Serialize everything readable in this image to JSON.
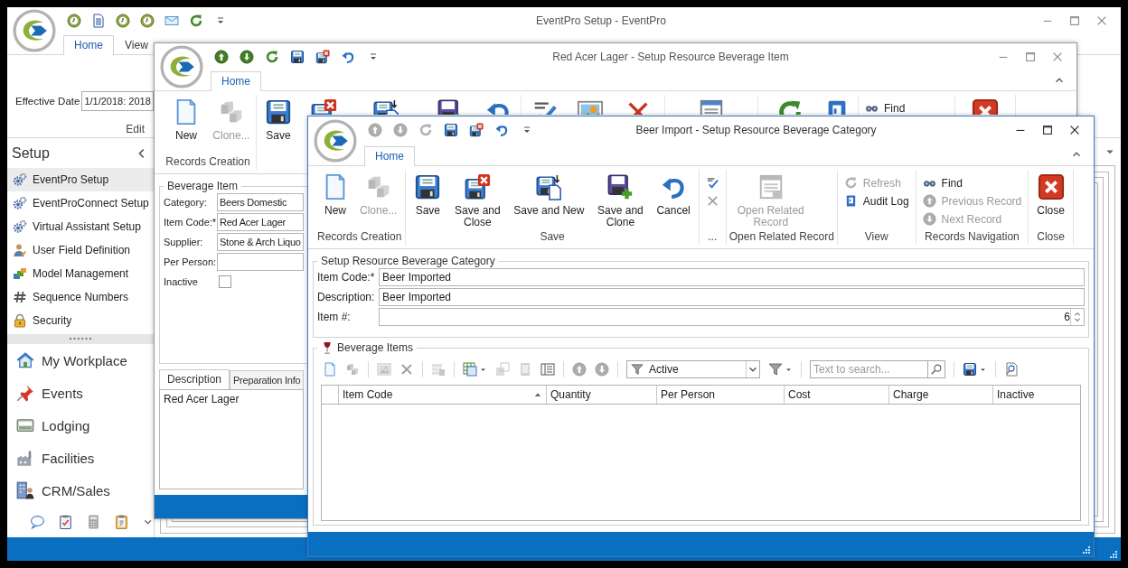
{
  "main_window": {
    "title": "EventPro Setup - EventPro",
    "quick_access": [
      {
        "kind": "clock",
        "disabled": false
      },
      {
        "kind": "doc",
        "disabled": false
      },
      {
        "kind": "clock",
        "disabled": false
      },
      {
        "kind": "clock",
        "disabled": false
      },
      {
        "kind": "mail",
        "disabled": false
      },
      {
        "kind": "refresh",
        "disabled": false
      },
      {
        "kind": "customize",
        "disabled": false
      }
    ],
    "tabs": [
      {
        "label": "Home",
        "selected": true
      },
      {
        "label": "View",
        "selected": false
      }
    ],
    "effective_date": {
      "label": "Effective Date",
      "value": "1/1/2018: 2018"
    },
    "ribbon_group": "Edit",
    "sidebar": {
      "title": "Setup",
      "items": [
        {
          "label": "EventPro Setup",
          "kind": "gear",
          "selected": true
        },
        {
          "label": "EventProConnect Setup",
          "kind": "gear",
          "selected": false
        },
        {
          "label": "Virtual Assistant Setup",
          "kind": "gear",
          "selected": false
        },
        {
          "label": "User Field Definition",
          "kind": "user",
          "selected": false
        },
        {
          "label": "Model Management",
          "kind": "model",
          "selected": false
        },
        {
          "label": "Sequence Numbers",
          "kind": "hash",
          "selected": false
        },
        {
          "label": "Security",
          "kind": "lock",
          "selected": false
        }
      ],
      "nav": [
        {
          "label": "My Workplace",
          "kind": "home"
        },
        {
          "label": "Events",
          "kind": "pin"
        },
        {
          "label": "Lodging",
          "kind": "bed"
        },
        {
          "label": "Facilities",
          "kind": "factory"
        },
        {
          "label": "CRM/Sales",
          "kind": "crm"
        }
      ],
      "shortcuts": [
        {
          "kind": "chat"
        },
        {
          "kind": "checklist"
        },
        {
          "kind": "calculator"
        },
        {
          "kind": "clipboard"
        },
        {
          "kind": "chevron_down"
        }
      ]
    }
  },
  "item_window": {
    "title": "Red Acer Lager - Setup Resource Beverage Item",
    "quick_access": [
      {
        "kind": "up",
        "disabled": false
      },
      {
        "kind": "down",
        "disabled": false
      },
      {
        "kind": "refresh",
        "disabled": false
      },
      {
        "kind": "save",
        "disabled": false
      },
      {
        "kind": "save_close",
        "disabled": false
      },
      {
        "kind": "undo",
        "disabled": false
      },
      {
        "kind": "customize",
        "disabled": false
      }
    ],
    "tabs": [
      {
        "label": "Home",
        "selected": true
      }
    ],
    "ribbon_groups": [
      {
        "label": "Records Creation",
        "kind": "large",
        "buttons": [
          {
            "kind": "new",
            "label": "New",
            "disabled": false
          },
          {
            "kind": "clone",
            "label": "Clone...",
            "disabled": true
          }
        ]
      },
      {
        "kind": "large",
        "buttons": [
          {
            "kind": "save",
            "label": "Save",
            "disabled": false
          },
          {
            "kind": "save_close",
            "disabled": false
          },
          {
            "kind": "save_new",
            "disabled": false
          },
          {
            "kind": "save_clone",
            "disabled": false
          },
          {
            "kind": "undo",
            "disabled": false
          }
        ]
      },
      {
        "kind": "large",
        "buttons": [
          {
            "kind": "spell",
            "disabled": false
          },
          {
            "kind": "picture",
            "disabled": false
          },
          {
            "kind": "delete",
            "disabled": false
          }
        ]
      },
      {
        "kind": "large",
        "buttons": [
          {
            "kind": "related",
            "disabled": false
          }
        ]
      },
      {
        "kind": "large",
        "buttons": [
          {
            "kind": "refresh",
            "disabled": false
          },
          {
            "kind": "audit",
            "disabled": false
          }
        ]
      },
      {
        "kind": "small",
        "buttons": [
          {
            "kind": "find",
            "label": "Find",
            "disabled": false
          }
        ]
      },
      {
        "kind": "large",
        "buttons": [
          {
            "kind": "close_red",
            "disabled": false
          }
        ]
      }
    ],
    "form": {
      "title": "Beverage Item",
      "fields": [
        {
          "kind": "text",
          "label": "Category:",
          "value": "Beers Domestic"
        },
        {
          "kind": "text",
          "label": "Item Code:*",
          "value": "Red Acer Lager"
        },
        {
          "kind": "text",
          "label": "Supplier:",
          "value": "Stone & Arch Liquo"
        },
        {
          "kind": "text",
          "label": "Per Person:"
        },
        {
          "kind": "checkbox",
          "label": "Inactive",
          "checked": false
        }
      ]
    },
    "detail_tabs": [
      {
        "label": "Description",
        "selected": true
      },
      {
        "label": "Preparation Info",
        "selected": false
      }
    ],
    "description": "Red Acer Lager"
  },
  "category_window": {
    "title": "Beer Import - Setup Resource Beverage Category",
    "quick_access": [
      {
        "kind": "up",
        "disabled": true
      },
      {
        "kind": "down",
        "disabled": true
      },
      {
        "kind": "refresh",
        "disabled": true
      },
      {
        "kind": "save",
        "disabled": false
      },
      {
        "kind": "save_close",
        "disabled": false
      },
      {
        "kind": "undo",
        "disabled": false
      },
      {
        "kind": "customize",
        "disabled": false
      }
    ],
    "tabs": [
      {
        "label": "Home",
        "selected": true
      }
    ],
    "ribbon_groups": [
      {
        "label": "Records Creation",
        "kind": "large",
        "buttons": [
          {
            "kind": "new",
            "label": "New",
            "disabled": false
          },
          {
            "kind": "clone",
            "label": "Clone...",
            "disabled": true
          }
        ]
      },
      {
        "label": "Save",
        "kind": "large",
        "buttons": [
          {
            "kind": "save",
            "label": "Save",
            "disabled": false
          },
          {
            "kind": "save_close",
            "label": "Save and Close",
            "disabled": false
          },
          {
            "kind": "save_new",
            "label": "Save and New",
            "disabled": false
          },
          {
            "kind": "save_clone",
            "label": "Save and Clone",
            "disabled": false
          },
          {
            "kind": "undo",
            "label": "Cancel",
            "disabled": false
          }
        ]
      },
      {
        "label": "...",
        "kind": "small",
        "buttons": [
          {
            "kind": "spell",
            "disabled": false
          },
          {
            "kind": "delete",
            "disabled": true
          }
        ]
      },
      {
        "label": "Open Related Record",
        "kind": "large",
        "buttons": [
          {
            "kind": "related",
            "label": "Open Related Record",
            "disabled": true
          }
        ]
      },
      {
        "label": "View",
        "kind": "small",
        "buttons": [
          {
            "kind": "refresh",
            "label": "Refresh",
            "disabled": true
          },
          {
            "kind": "audit",
            "label": "Audit Log",
            "disabled": false
          }
        ]
      },
      {
        "label": "Records Navigation",
        "kind": "small",
        "buttons": [
          {
            "kind": "find",
            "label": "Find",
            "disabled": false
          },
          {
            "kind": "up",
            "label": "Previous Record",
            "disabled": true
          },
          {
            "kind": "down",
            "label": "Next Record",
            "disabled": true
          }
        ]
      },
      {
        "label": "Close",
        "kind": "large",
        "buttons": [
          {
            "kind": "close_red",
            "label": "Close",
            "disabled": false
          }
        ]
      }
    ],
    "form": {
      "title": "Setup Resource Beverage Category",
      "fields": [
        {
          "kind": "text",
          "label": "Item Code:*",
          "value": "Beer Imported"
        },
        {
          "kind": "text",
          "label": "Description:",
          "value": "Beer Imported"
        },
        {
          "kind": "spinner",
          "label": "Item #:",
          "value": "6"
        }
      ]
    },
    "items_panel": {
      "title": "Beverage Items",
      "toolbar": [
        {
          "kind": "new",
          "disabled": false
        },
        {
          "kind": "clone",
          "disabled": true
        },
        {
          "kind": "separator"
        },
        {
          "kind": "picture",
          "disabled": true
        },
        {
          "kind": "delete",
          "disabled": true
        },
        {
          "kind": "separator"
        },
        {
          "kind": "rows",
          "disabled": true
        },
        {
          "kind": "separator"
        },
        {
          "kind": "grid_menu",
          "disabled": false,
          "dropdown": true
        },
        {
          "kind": "restore",
          "disabled": true
        },
        {
          "kind": "device",
          "disabled": true
        },
        {
          "kind": "details",
          "disabled": false
        },
        {
          "kind": "separator"
        },
        {
          "kind": "up",
          "disabled": true
        },
        {
          "kind": "down",
          "disabled": true
        },
        {
          "kind": "separator"
        },
        {
          "kind": "combo",
          "value": "Active"
        },
        {
          "kind": "filter",
          "disabled": false,
          "dropdown": true
        },
        {
          "kind": "separator"
        },
        {
          "kind": "search",
          "placeholder": "Text to search..."
        },
        {
          "kind": "separator"
        },
        {
          "kind": "save",
          "disabled": false,
          "dropdown": true
        },
        {
          "kind": "separator"
        },
        {
          "kind": "find_page",
          "disabled": false
        }
      ],
      "columns": [
        {
          "label": "Item Code",
          "sorted": true
        },
        {
          "label": "Quantity",
          "sorted": false
        },
        {
          "label": "Per Person",
          "sorted": false
        },
        {
          "label": "Cost",
          "sorted": false
        },
        {
          "label": "Charge",
          "sorted": false
        },
        {
          "label": "Inactive",
          "sorted": false
        }
      ]
    }
  }
}
